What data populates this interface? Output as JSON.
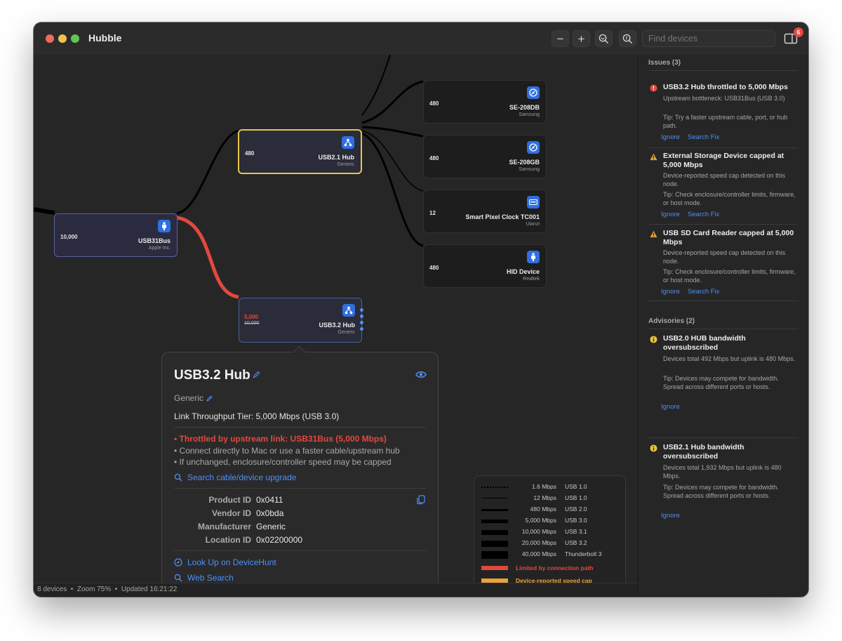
{
  "window": {
    "title": "Hubble"
  },
  "toolbar": {
    "search_placeholder": "Find devices",
    "badge_count": "6"
  },
  "nodes": {
    "usb31bus": {
      "speed": "10,000",
      "name": "USB31Bus",
      "vendor": "Apple Inc."
    },
    "usb21hub": {
      "speed": "480",
      "name": "USB2.1 Hub",
      "vendor": "Generic"
    },
    "usb32hub": {
      "speed": "5,000",
      "speed_struck": "10,000",
      "name": "USB3.2 Hub",
      "vendor": "Generic"
    },
    "se208db": {
      "speed": "480",
      "name": "SE-208DB",
      "vendor": "Samsung"
    },
    "se208gb": {
      "speed": "480",
      "name": "SE-208GB",
      "vendor": "Samsung"
    },
    "clock": {
      "speed": "12",
      "name": "Smart Pixel Clock TC001",
      "vendor": "Ulanzi"
    },
    "hid": {
      "speed": "480",
      "name": "HID Device",
      "vendor": "Realtek"
    }
  },
  "popover": {
    "title": "USB3.2 Hub",
    "manufacturer": "Generic",
    "tier": "Link Throughput Tier: 5,000 Mbps (USB 3.0)",
    "warning": "• Throttled by upstream link: USB31Bus (5,000 Mbps)",
    "bullets": [
      "• Connect directly to Mac or use a faster cable/upstream hub",
      "• If unchanged, enclosure/controller speed may be capped"
    ],
    "search_upgrade": "Search cable/device upgrade",
    "fields": [
      {
        "key": "Product ID",
        "value": "0x0411"
      },
      {
        "key": "Vendor ID",
        "value": "0x0bda"
      },
      {
        "key": "Manufacturer",
        "value": "Generic"
      },
      {
        "key": "Location ID",
        "value": "0x02200000"
      }
    ],
    "lookup": "Look Up on DeviceHunt",
    "web_search": "Web Search"
  },
  "legend": {
    "rows": [
      {
        "speed": "1.6 Mbps",
        "name": "USB 1.0"
      },
      {
        "speed": "12 Mbps",
        "name": "USB 1.0"
      },
      {
        "speed": "480 Mbps",
        "name": "USB 2.0"
      },
      {
        "speed": "5,000 Mbps",
        "name": "USB 3.0"
      },
      {
        "speed": "10,000 Mbps",
        "name": "USB 3.1"
      },
      {
        "speed": "20,000 Mbps",
        "name": "USB 3.2"
      },
      {
        "speed": "40,000 Mbps",
        "name": "Thunderbolt 3"
      }
    ],
    "limited": "Limited by connection path",
    "capped": "Device-reported speed cap",
    "limited_color": "#e2483d",
    "capped_color": "#e9a23b"
  },
  "status": {
    "text": "8 devices  •  Zoom 75%  •  Updated 16:21:22"
  },
  "panel": {
    "issues_header": "Issues (3)",
    "issues": [
      {
        "title": "USB3.2 Hub throttled to 5,000 Mbps",
        "desc": "Upstream bottleneck: USB31Bus (USB 3.0)",
        "tip": "Tip: Try a faster upstream cable, port, or hub path.",
        "ignore": "Ignore",
        "search": "Search Fix"
      },
      {
        "title": "External Storage Device capped at 5,000 Mbps",
        "desc": "Device-reported speed cap detected on this node.",
        "tip": "Tip: Check enclosure/controller limits, firmware, or host mode.",
        "ignore": "Ignore",
        "search": "Search Fix"
      },
      {
        "title": "USB SD Card Reader capped at 5,000 Mbps",
        "desc": "Device-reported speed cap detected on this node.",
        "tip": "Tip: Check enclosure/controller limits, firmware, or host mode.",
        "ignore": "Ignore",
        "search": "Search Fix"
      }
    ],
    "advisories_header": "Advisories (2)",
    "advisories": [
      {
        "title": "USB2.0 HUB bandwidth oversubscribed",
        "desc": "Devices total 492 Mbps but uplink is 480 Mbps.",
        "tip": "Tip: Devices may compete for bandwidth. Spread across different ports or hosts.",
        "ignore": "Ignore"
      },
      {
        "title": "USB2.1 Hub bandwidth oversubscribed",
        "desc": "Devices total 1,932 Mbps but uplink is 480 Mbps.",
        "tip": "Tip: Devices may compete for bandwidth. Spread across different ports or hosts.",
        "ignore": "Ignore"
      }
    ]
  },
  "colors": {
    "error": "#e2483d",
    "warning": "#e9a23b",
    "accent": "#4f8ff7",
    "selected_border": "#e2c64a"
  }
}
